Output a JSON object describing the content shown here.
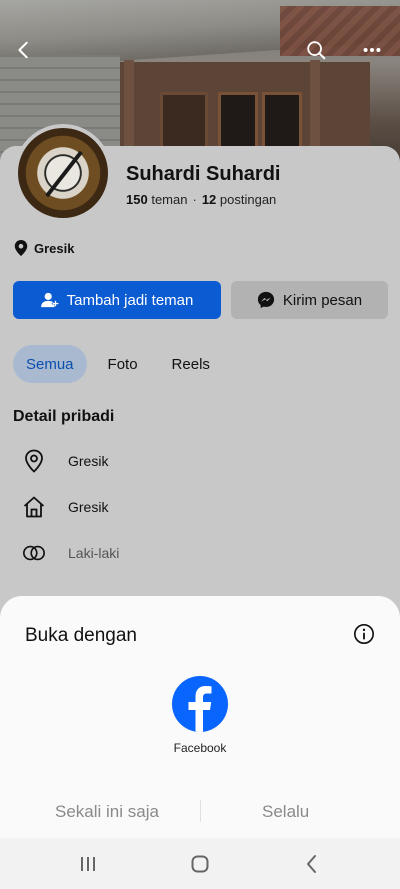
{
  "profile": {
    "name": "Suhardi Suhardi",
    "friends_count": "150",
    "friends_label": "teman",
    "separator": "·",
    "posts_count": "12",
    "posts_label": "postingan",
    "location": "Gresik"
  },
  "header": {
    "back_icon": "back-arrow-icon",
    "search_icon": "search-icon",
    "more_icon": "more-icon"
  },
  "actions": {
    "add_friend": "Tambah jadi teman",
    "message": "Kirim pesan"
  },
  "tabs": [
    {
      "label": "Semua",
      "active": true
    },
    {
      "label": "Foto",
      "active": false
    },
    {
      "label": "Reels",
      "active": false
    }
  ],
  "details": {
    "title": "Detail pribadi",
    "items": [
      {
        "icon": "location-pin-icon",
        "label": "Gresik"
      },
      {
        "icon": "home-icon",
        "label": "Gresik"
      },
      {
        "icon": "gender-rings-icon",
        "label": "Laki-laki"
      }
    ]
  },
  "open_with_sheet": {
    "title": "Buka dengan",
    "app_label": "Facebook",
    "once_label": "Sekali ini saja",
    "always_label": "Selalu"
  },
  "navbar": {
    "recents_icon": "recents-icon",
    "home_icon": "home-button-icon",
    "back_icon": "nav-back-icon"
  },
  "colors": {
    "primary_button": "#0b5bd3",
    "facebook_blue": "#0866ff",
    "active_tab_bg": "#a9b9cf",
    "overlay_bg": "#c8c8c8"
  }
}
